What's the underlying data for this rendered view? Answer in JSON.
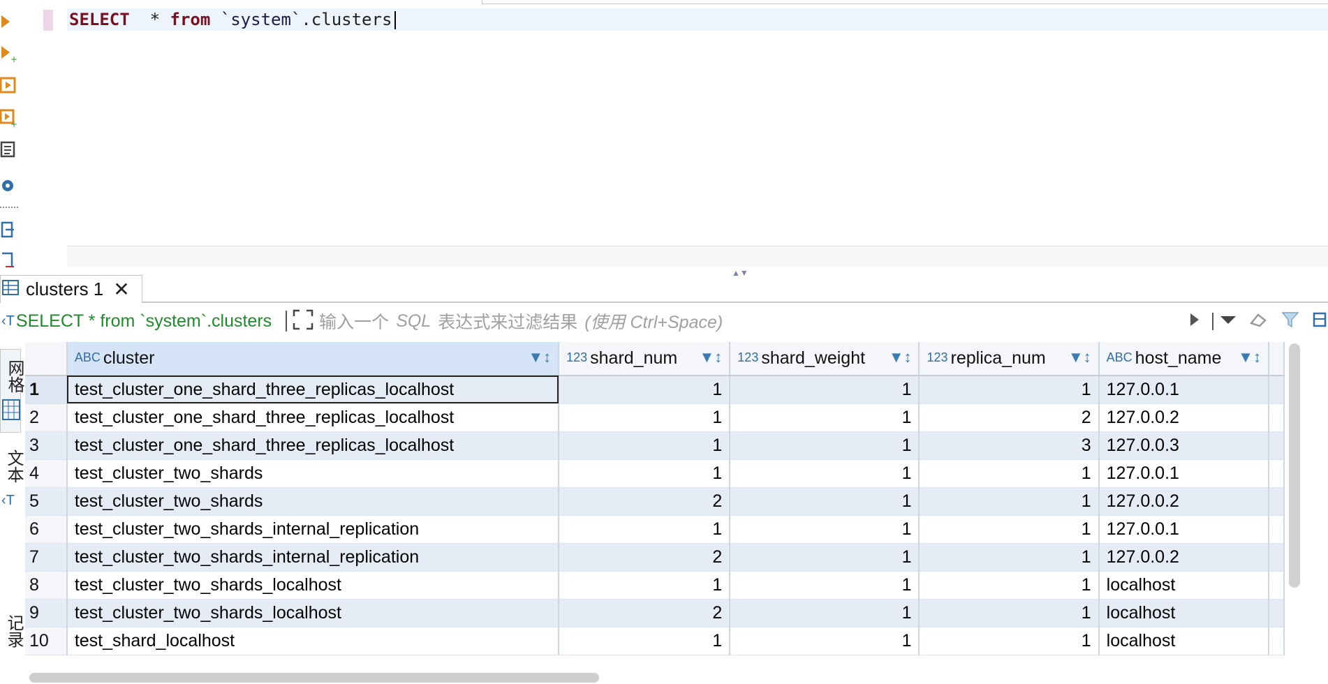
{
  "editor": {
    "kw_select": "SELECT",
    "op_star": "*",
    "kw_from": "from",
    "ident": "`system`",
    "table": ".clusters"
  },
  "result_tab": {
    "label": "clusters 1",
    "close": "✕"
  },
  "filter": {
    "query": "SELECT * from `system`.clusters",
    "placeholder_a": "输入一个",
    "placeholder_b": "SQL",
    "placeholder_c": "表达式来过滤结果",
    "placeholder_d": "(使用 Ctrl+Space)"
  },
  "side_tabs": {
    "grid": "网格",
    "text": "文本",
    "records": "记录"
  },
  "grid": {
    "columns": [
      {
        "type": "ABC",
        "name": "cluster"
      },
      {
        "type": "123",
        "name": "shard_num"
      },
      {
        "type": "123",
        "name": "shard_weight"
      },
      {
        "type": "123",
        "name": "replica_num"
      },
      {
        "type": "ABC",
        "name": "host_name"
      }
    ],
    "rows": [
      {
        "n": "1",
        "cluster": "test_cluster_one_shard_three_replicas_localhost",
        "shard_num": "1",
        "shard_weight": "1",
        "replica_num": "1",
        "host_name": "127.0.0.1"
      },
      {
        "n": "2",
        "cluster": "test_cluster_one_shard_three_replicas_localhost",
        "shard_num": "1",
        "shard_weight": "1",
        "replica_num": "2",
        "host_name": "127.0.0.2"
      },
      {
        "n": "3",
        "cluster": "test_cluster_one_shard_three_replicas_localhost",
        "shard_num": "1",
        "shard_weight": "1",
        "replica_num": "3",
        "host_name": "127.0.0.3"
      },
      {
        "n": "4",
        "cluster": "test_cluster_two_shards",
        "shard_num": "1",
        "shard_weight": "1",
        "replica_num": "1",
        "host_name": "127.0.0.1"
      },
      {
        "n": "5",
        "cluster": "test_cluster_two_shards",
        "shard_num": "2",
        "shard_weight": "1",
        "replica_num": "1",
        "host_name": "127.0.0.2"
      },
      {
        "n": "6",
        "cluster": "test_cluster_two_shards_internal_replication",
        "shard_num": "1",
        "shard_weight": "1",
        "replica_num": "1",
        "host_name": "127.0.0.1"
      },
      {
        "n": "7",
        "cluster": "test_cluster_two_shards_internal_replication",
        "shard_num": "2",
        "shard_weight": "1",
        "replica_num": "1",
        "host_name": "127.0.0.2"
      },
      {
        "n": "8",
        "cluster": "test_cluster_two_shards_localhost",
        "shard_num": "1",
        "shard_weight": "1",
        "replica_num": "1",
        "host_name": "localhost"
      },
      {
        "n": "9",
        "cluster": "test_cluster_two_shards_localhost",
        "shard_num": "2",
        "shard_weight": "1",
        "replica_num": "1",
        "host_name": "localhost"
      },
      {
        "n": "10",
        "cluster": "test_shard_localhost",
        "shard_num": "1",
        "shard_weight": "1",
        "replica_num": "1",
        "host_name": "localhost"
      }
    ]
  },
  "colors": {
    "keyword": "#7a0f1f",
    "filter_query": "#1e8a2b",
    "row_alt": "#e6ecf5",
    "selection": "#d6e4f7"
  },
  "icons": [
    "execute-statement-icon",
    "execute-new-tab-icon",
    "execute-script-icon",
    "execute-script-new-tab-icon",
    "explain-plan-icon",
    "settings-icon",
    "history-icon",
    "filter-sort-icon",
    "close-icon"
  ]
}
